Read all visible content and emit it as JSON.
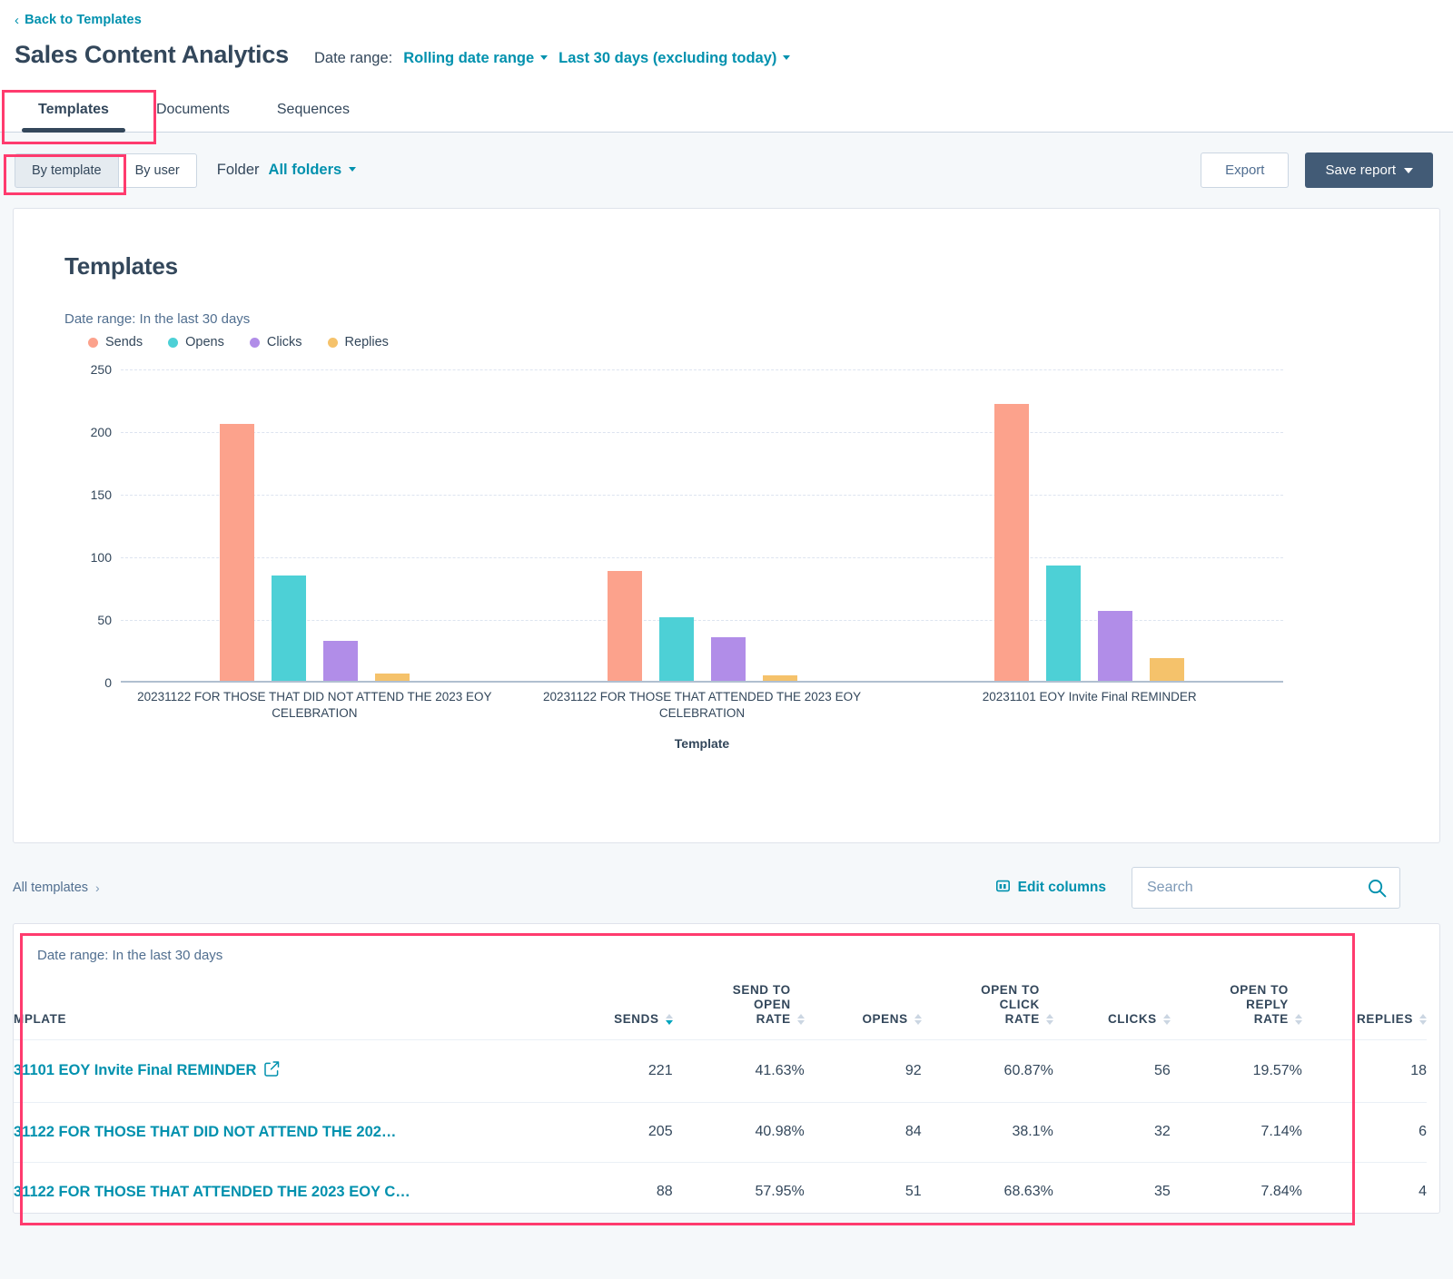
{
  "header": {
    "back_link": "Back to Templates",
    "back_icon": "chevron-left-icon",
    "title": "Sales Content Analytics",
    "date_range_label": "Date range:",
    "date_range_type": "Rolling date range",
    "date_range_value": "Last 30 days (excluding today)"
  },
  "tabs": [
    {
      "label": "Templates",
      "active": true
    },
    {
      "label": "Documents",
      "active": false
    },
    {
      "label": "Sequences",
      "active": false
    }
  ],
  "controls": {
    "by_template": "By template",
    "by_user": "By user",
    "folder_label": "Folder",
    "folder_value": "All folders",
    "export": "Export",
    "save_report": "Save report"
  },
  "chart_card": {
    "title": "Templates",
    "date_range_note": "Date range: In the last 30 days"
  },
  "chart_data": {
    "type": "bar",
    "title": "Templates",
    "subtitle": "Date range: In the last 30 days",
    "xlabel": "Template",
    "ylabel": "",
    "ylim": [
      0,
      250
    ],
    "yticks": [
      0,
      50,
      100,
      150,
      200,
      250
    ],
    "grid": true,
    "legend_position": "top-left",
    "categories": [
      "20231122 FOR THOSE THAT DID NOT ATTEND THE 2023 EOY CELEBRATION",
      "20231122 FOR THOSE THAT ATTENDED THE 2023 EOY CELEBRATION",
      "20231101 EOY Invite Final REMINDER"
    ],
    "series": [
      {
        "name": "Sends",
        "color": "#FCA28C",
        "values": [
          205,
          88,
          221
        ]
      },
      {
        "name": "Opens",
        "color": "#4DD0D6",
        "values": [
          84,
          51,
          92
        ]
      },
      {
        "name": "Clicks",
        "color": "#B18DE8",
        "values": [
          32,
          35,
          56
        ]
      },
      {
        "name": "Replies",
        "color": "#F5C26B",
        "values": [
          6,
          4,
          18
        ]
      }
    ]
  },
  "table_toolbar": {
    "breadcrumb": "All templates",
    "breadcrumb_chevron": "›",
    "edit_columns": "Edit columns",
    "edit_columns_icon": "columns-icon",
    "search_placeholder": "Search",
    "search_value": "",
    "search_icon": "search-icon"
  },
  "table": {
    "date_range_note": "Date range: In the last 30 days",
    "columns": [
      {
        "label": "MPLATE",
        "sortable": false,
        "sorted": "none",
        "align": "left"
      },
      {
        "label": "SENDS",
        "sortable": true,
        "sorted": "desc",
        "align": "right"
      },
      {
        "label": "SEND TO OPEN RATE",
        "sortable": true,
        "sorted": "none",
        "align": "right"
      },
      {
        "label": "OPENS",
        "sortable": true,
        "sorted": "none",
        "align": "right"
      },
      {
        "label": "OPEN TO CLICK RATE",
        "sortable": true,
        "sorted": "none",
        "align": "right"
      },
      {
        "label": "CLICKS",
        "sortable": true,
        "sorted": "none",
        "align": "right"
      },
      {
        "label": "OPEN TO REPLY RATE",
        "sortable": true,
        "sorted": "none",
        "align": "right"
      },
      {
        "label": "REPLIES",
        "sortable": true,
        "sorted": "none",
        "align": "right"
      }
    ],
    "rows": [
      {
        "template": "31101 EOY Invite Final REMINDER",
        "has_external_icon": true,
        "sends": "221",
        "send_to_open_rate": "41.63%",
        "opens": "92",
        "open_to_click_rate": "60.87%",
        "clicks": "56",
        "open_to_reply_rate": "19.57%",
        "replies": "18"
      },
      {
        "template": "31122 FOR THOSE THAT DID NOT ATTEND THE 202…",
        "has_external_icon": false,
        "sends": "205",
        "send_to_open_rate": "40.98%",
        "opens": "84",
        "open_to_click_rate": "38.1%",
        "clicks": "32",
        "open_to_reply_rate": "7.14%",
        "replies": "6"
      },
      {
        "template": "31122 FOR THOSE THAT ATTENDED THE 2023 EOY C…",
        "has_external_icon": false,
        "sends": "88",
        "send_to_open_rate": "57.95%",
        "opens": "51",
        "open_to_click_rate": "68.63%",
        "clicks": "35",
        "open_to_reply_rate": "7.84%",
        "replies": "4"
      }
    ]
  },
  "highlight_color": "#FF3B6E"
}
